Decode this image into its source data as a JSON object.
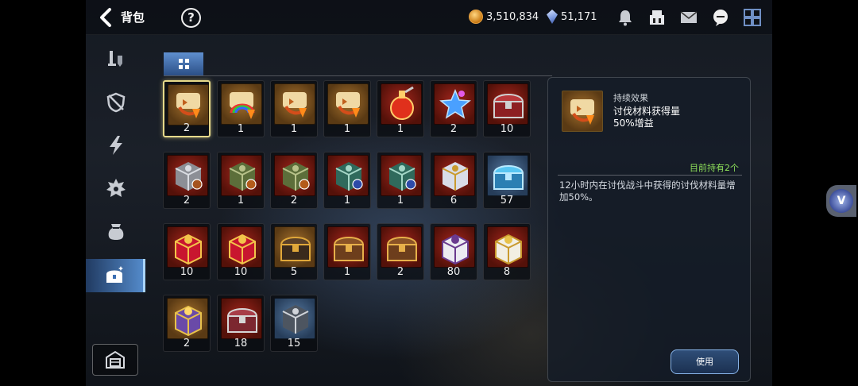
{
  "header": {
    "title": "背包",
    "help_label": "?",
    "gold": "3,510,834",
    "crystal": "51,171",
    "icons": [
      "bell-icon",
      "guild-icon",
      "mail-icon",
      "chat-icon",
      "menu-grid-icon"
    ]
  },
  "sidebar": {
    "items": [
      {
        "name": "weapon-icon"
      },
      {
        "name": "shield-icon"
      },
      {
        "name": "lightning-icon"
      },
      {
        "name": "spiky-gem-icon"
      },
      {
        "name": "pouch-icon"
      },
      {
        "name": "treasure-chest-icon",
        "active": true
      },
      {
        "name": "storage-icon"
      }
    ]
  },
  "inventory": {
    "items": [
      {
        "icon": "scroll-claw-icon",
        "bg": "amber",
        "count": "2",
        "selected": true
      },
      {
        "icon": "scroll-rainbow-icon",
        "bg": "amber",
        "count": "1"
      },
      {
        "icon": "scroll-claw-icon",
        "bg": "amber",
        "count": "1"
      },
      {
        "icon": "scroll-claw-icon",
        "bg": "amber",
        "count": "1"
      },
      {
        "icon": "red-potion-icon",
        "bg": "red",
        "count": "1"
      },
      {
        "icon": "blue-star-icon",
        "bg": "red",
        "count": "2"
      },
      {
        "icon": "red-chest-icon",
        "bg": "red",
        "count": "10"
      },
      {
        "icon": "silver-cube-icon",
        "bg": "red",
        "count": "2"
      },
      {
        "icon": "green-cube-icon",
        "bg": "red",
        "count": "1"
      },
      {
        "icon": "green-cube-icon",
        "bg": "red",
        "count": "2"
      },
      {
        "icon": "teal-cube-icon",
        "bg": "red",
        "count": "1"
      },
      {
        "icon": "teal-cube-icon",
        "bg": "red",
        "count": "1"
      },
      {
        "icon": "white-gold-cube-icon",
        "bg": "red",
        "count": "6"
      },
      {
        "icon": "blue-chest-icon",
        "bg": "blue",
        "count": "57"
      },
      {
        "icon": "red-gift-box-icon",
        "bg": "red",
        "count": "10"
      },
      {
        "icon": "red-gift-box-icon",
        "bg": "red",
        "count": "10"
      },
      {
        "icon": "dark-gold-chest-icon",
        "bg": "amber",
        "count": "5"
      },
      {
        "icon": "wood-gold-chest-icon",
        "bg": "red",
        "count": "1"
      },
      {
        "icon": "wood-gold-chest-icon",
        "bg": "red",
        "count": "2"
      },
      {
        "icon": "white-purple-box-icon",
        "bg": "red",
        "count": "80"
      },
      {
        "icon": "white-gold-box-icon",
        "bg": "red",
        "count": "8"
      },
      {
        "icon": "purple-gold-box-icon",
        "bg": "amber",
        "count": "2"
      },
      {
        "icon": "crimson-chest-icon",
        "bg": "red",
        "count": "18"
      },
      {
        "icon": "steel-cube-icon",
        "bg": "blue",
        "count": "15"
      }
    ]
  },
  "detail": {
    "type": "持续效果",
    "name_line1": "讨伐材料获得量",
    "name_line2": "50%增益",
    "owned": "目前持有2个",
    "description": "12小时内在讨伐战斗中获得的讨伐材料量增加50%。",
    "use_label": "使用"
  },
  "floating": {
    "label": "V"
  }
}
